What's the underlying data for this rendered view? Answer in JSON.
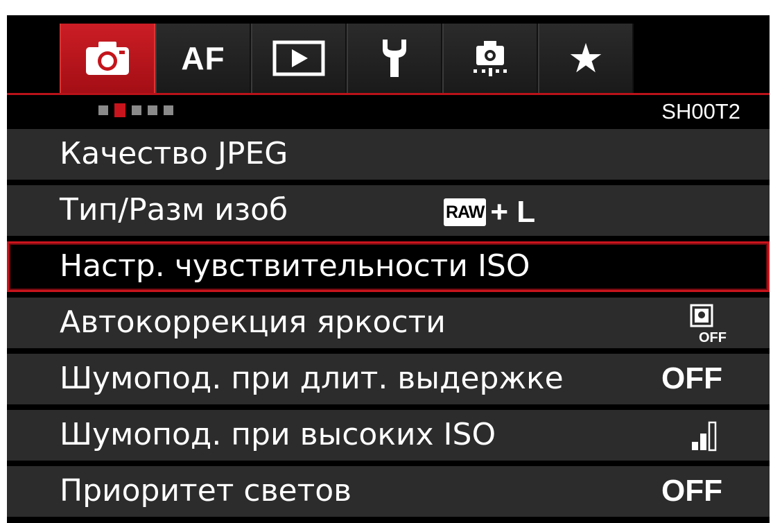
{
  "tabs": [
    {
      "name": "camera-icon",
      "label": "",
      "active": true
    },
    {
      "name": "af",
      "label": "AF",
      "active": false
    },
    {
      "name": "play-icon",
      "label": "",
      "active": false
    },
    {
      "name": "wrench-icon",
      "label": "",
      "active": false
    },
    {
      "name": "custom-icon",
      "label": "",
      "active": false
    },
    {
      "name": "star-icon",
      "label": "★",
      "active": false
    }
  ],
  "page_dots": {
    "count": 5,
    "active_index": 1
  },
  "section_id": "SH00T2",
  "menu": {
    "items": [
      {
        "label": "Качество JPEG",
        "value": ""
      },
      {
        "label": "Тип/Разм изоб",
        "value_badge": "RAW",
        "value_text": "+ L"
      },
      {
        "label": "Настр. чувствительности ISO",
        "value": "",
        "selected": true
      },
      {
        "label": "Автокоррекция яркости",
        "value_icon": "auto-lighting-off-icon",
        "value_icon_text": "OFF"
      },
      {
        "label": "Шумопод. при длит. выдержке",
        "value": "OFF"
      },
      {
        "label": "Шумопод. при высоких ISO",
        "value_icon": "noise-reduction-level-icon"
      },
      {
        "label": "Приоритет светов",
        "value": "OFF"
      }
    ]
  },
  "colors": {
    "accent": "#c8141c",
    "row_bg": "#2c2c2c",
    "screen_bg": "#000000"
  }
}
